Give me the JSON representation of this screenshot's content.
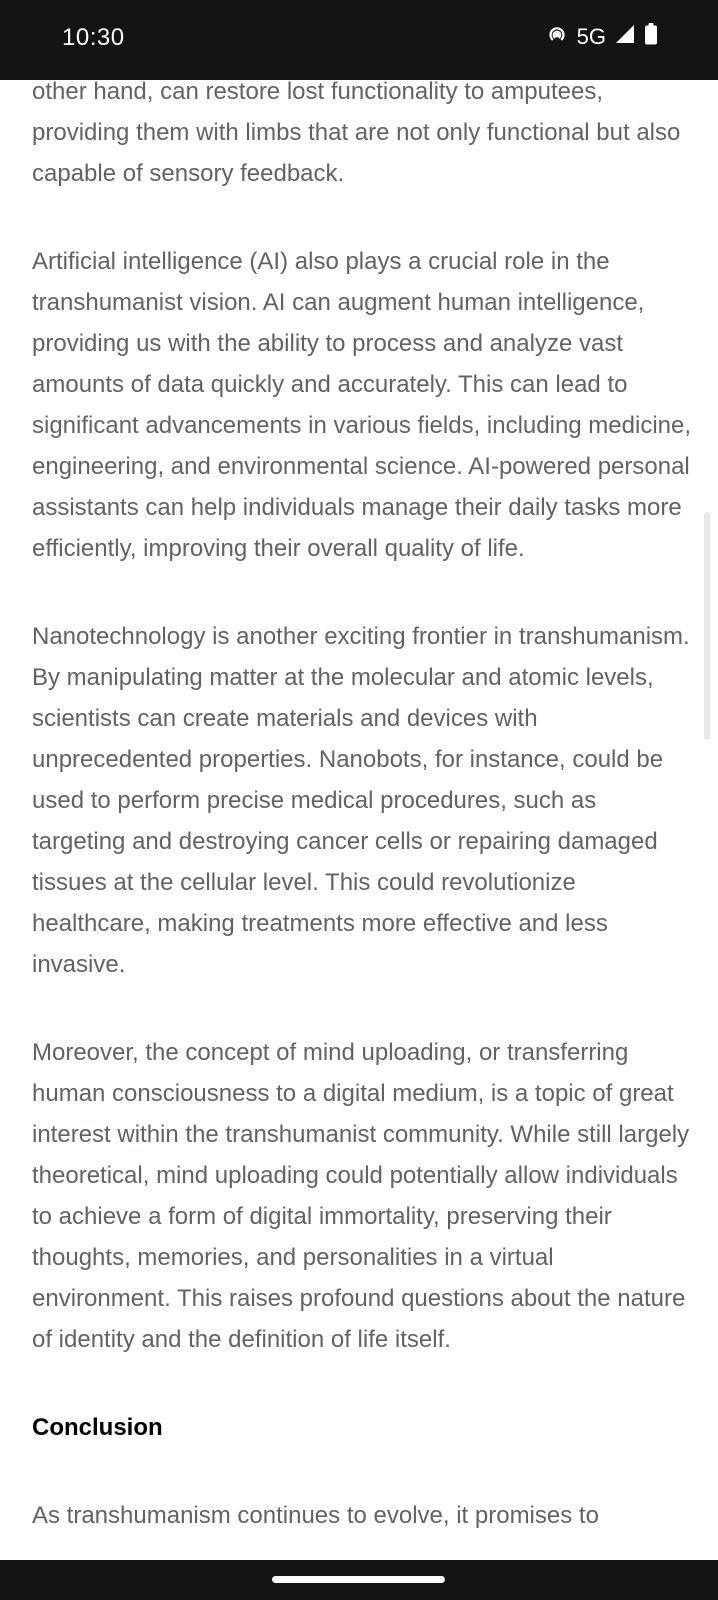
{
  "status_bar": {
    "time": "10:30",
    "network": "5G",
    "icons": [
      "hotspot-icon",
      "signal-icon",
      "battery-icon"
    ]
  },
  "article": {
    "partial_top_line": "other hand, can restore lost functionality to amputees,",
    "paragraphs": [
      "other hand, can restore lost functionality to amputees, providing them with limbs that are not only functional but also capable of sensory feedback.",
      "Artificial intelligence (AI) also plays a crucial role in the transhumanist vision. AI can augment human intelligence, providing us with the ability to process and analyze vast amounts of data quickly and accurately. This can lead to significant advancements in various fields, including medicine, engineering, and environmental science. AI-powered personal assistants can help individuals manage their daily tasks more efficiently, improving their overall quality of life.",
      "Nanotechnology is another exciting frontier in transhumanism. By manipulating matter at the molecular and atomic levels, scientists can create materials and devices with unprecedented properties. Nanobots, for instance, could be used to perform precise medical procedures, such as targeting and destroying cancer cells or repairing damaged tissues at the cellular level. This could revolutionize healthcare, making treatments more effective and less invasive.",
      "Moreover, the concept of mind uploading, or transferring human consciousness to a digital medium, is a topic of great interest within the transhumanist community. While still largely theoretical, mind uploading could potentially allow individuals to achieve a form of digital immortality, preserving their thoughts, memories, and personalities in a virtual environment. This raises profound questions about the nature of identity and the definition of life itself."
    ],
    "heading_conclusion": "Conclusion",
    "conclusion_start": "As transhumanism continues to evolve, it promises to"
  },
  "colors": {
    "body_text": "#5f6368",
    "heading": "#000000",
    "system_bars": "#121416"
  }
}
